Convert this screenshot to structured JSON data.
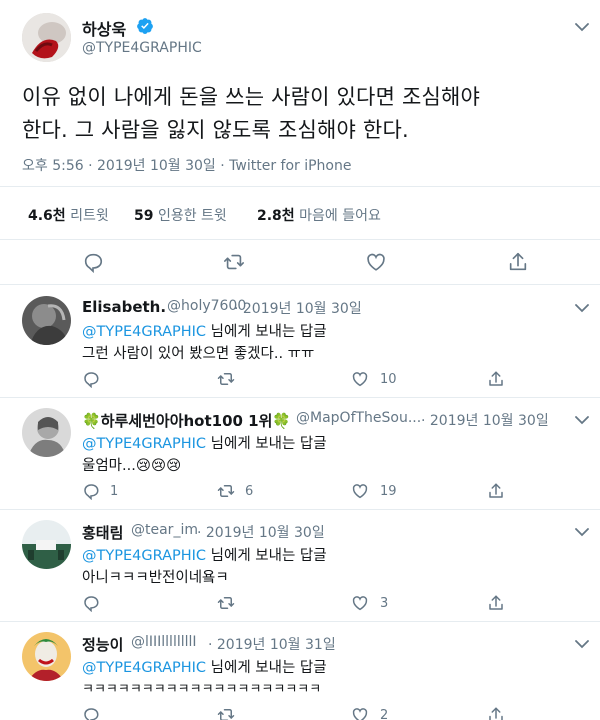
{
  "main_tweet": {
    "name": "하상욱",
    "handle": "@TYPE4GRAPHIC",
    "text_line1": "이유 없이 나에게 돈을 쓰는 사람이 있다면 조심해야",
    "text_line2": "한다. 그 사람을 잃지 않도록 조심해야 한다.",
    "timestamp": "오후 5:56 · 2019년 10월 30일 · Twitter for iPhone",
    "stats": {
      "retweets_count": "4.6천",
      "retweets_label": "리트윗",
      "quotes_count": "59",
      "quotes_label": "인용한 트윗",
      "likes_count": "2.8천",
      "likes_label": "마음에 들어요"
    }
  },
  "replies": [
    {
      "name": "Elisabeth.",
      "handle": "@holy7600",
      "date": "· 2019년 10월 30일",
      "reply_to_handle": "@TYPE4GRAPHIC",
      "reply_to_suffix": "님에게 보내는 답글",
      "text": "그런 사람이 있어 봤으면 좋겠다.. ㅠㅠ",
      "reply_count": "",
      "retweet_count": "",
      "like_count": "10"
    },
    {
      "name": "하루세번아아hot100 1위",
      "name_prefix_emoji": "🍀",
      "name_suffix_emoji": "🍀",
      "handle": "@MapOfTheSou...",
      "date": "· 2019년 10월 30일",
      "reply_to_handle": "@TYPE4GRAPHIC",
      "reply_to_suffix": "님에게 보내는 답글",
      "text": "울엄마...😢😢😢",
      "reply_count": "1",
      "retweet_count": "6",
      "like_count": "19"
    },
    {
      "name": "홍태림",
      "handle": "@tear_im",
      "date": "· 2019년 10월 30일",
      "reply_to_handle": "@TYPE4GRAPHIC",
      "reply_to_suffix": "님에게 보내는 답글",
      "text": "아니ㅋㅋㅋ반전이네욬ㅋ",
      "reply_count": "",
      "retweet_count": "",
      "like_count": "3"
    },
    {
      "name": "정능이",
      "handle": "@lIIIllllllllI",
      "date": "· 2019년 10월 31일",
      "reply_to_handle": "@TYPE4GRAPHIC",
      "reply_to_suffix": "님에게 보내는 답글",
      "text": "ㅋㅋㅋㅋㅋㅋㅋㅋㅋㅋㅋㅋㅋㅋㅋㅋㅋㅋㅋㅋ",
      "reply_count": "",
      "retweet_count": "",
      "like_count": "2"
    }
  ],
  "colors": {
    "accent": "#1b95e0",
    "verified": "#1da1f2",
    "muted": "#657786",
    "border": "#e6ecf0"
  },
  "icons": [
    "verified-badge-icon",
    "chevron-down-icon",
    "reply-icon",
    "retweet-icon",
    "like-icon",
    "share-icon"
  ]
}
